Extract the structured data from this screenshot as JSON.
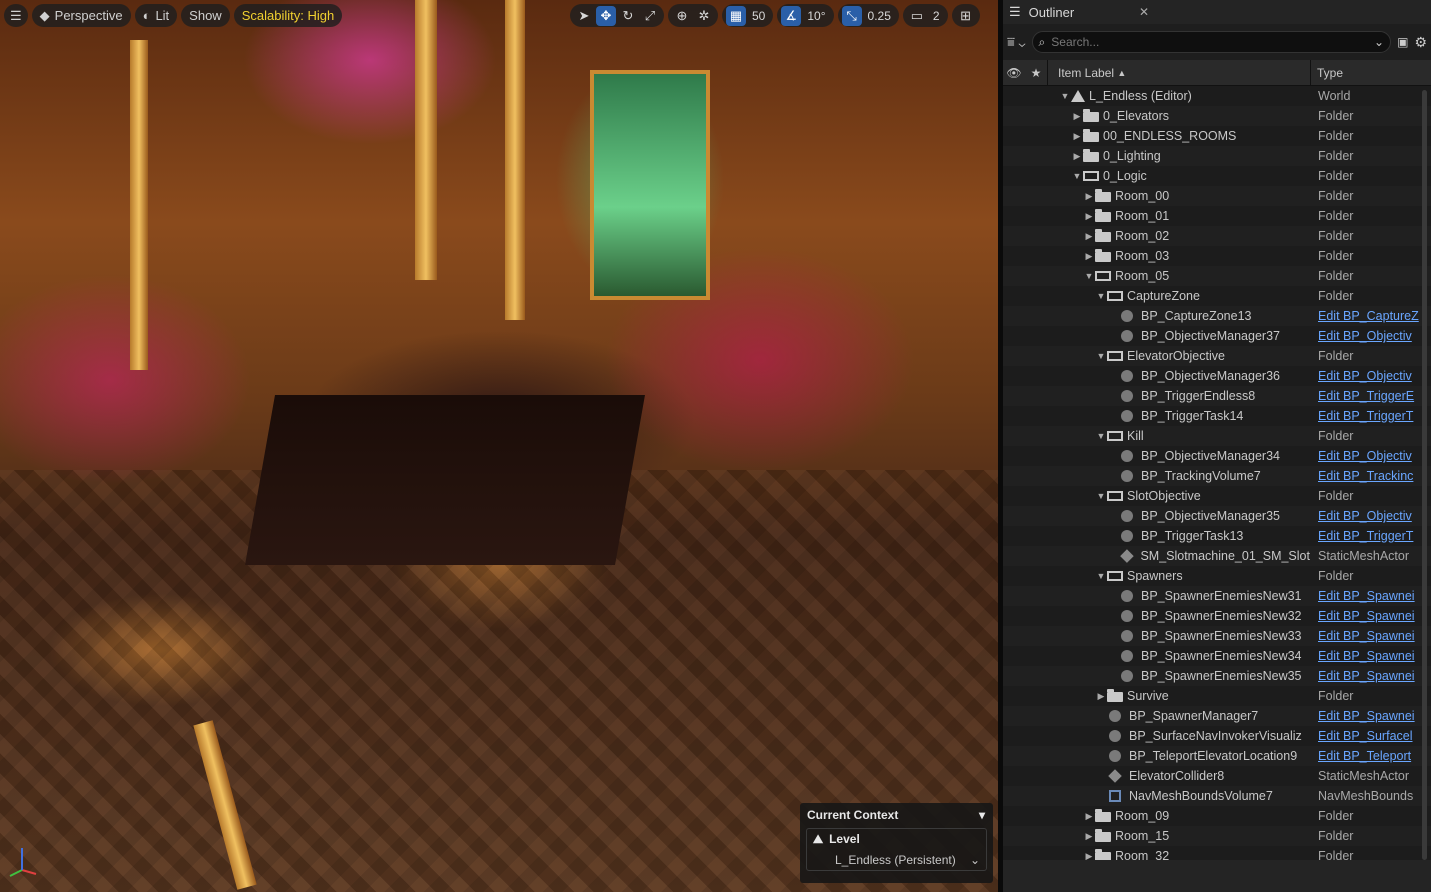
{
  "viewport": {
    "menu_icon": "hamburger-icon",
    "perspective_label": "Perspective",
    "lit_label": "Lit",
    "show_label": "Show",
    "scalability_label": "Scalability: High",
    "grid_snap_value": "50",
    "rotation_snap_value": "10°",
    "scale_snap_value": "0.25",
    "camera_speed_value": "2",
    "context": {
      "title": "Current Context",
      "level_label": "Level",
      "level_value": "L_Endless (Persistent)"
    }
  },
  "outliner": {
    "tab_title": "Outliner",
    "search_placeholder": "Search...",
    "col_label": "Item Label",
    "col_type": "Type",
    "rows": [
      {
        "indent": 0,
        "arrow": "▼",
        "icon": "world",
        "label": "L_Endless (Editor)",
        "type": "World",
        "link": false
      },
      {
        "indent": 1,
        "arrow": "▶",
        "icon": "folder",
        "label": "0_Elevators",
        "type": "Folder",
        "link": false
      },
      {
        "indent": 1,
        "arrow": "▶",
        "icon": "folder",
        "label": "00_ENDLESS_ROOMS",
        "type": "Folder",
        "link": false
      },
      {
        "indent": 1,
        "arrow": "▶",
        "icon": "folder",
        "label": "0_Lighting",
        "type": "Folder",
        "link": false
      },
      {
        "indent": 1,
        "arrow": "▼",
        "icon": "folder-open",
        "label": "0_Logic",
        "type": "Folder",
        "link": false
      },
      {
        "indent": 2,
        "arrow": "▶",
        "icon": "folder",
        "label": "Room_00",
        "type": "Folder",
        "link": false
      },
      {
        "indent": 2,
        "arrow": "▶",
        "icon": "folder",
        "label": "Room_01",
        "type": "Folder",
        "link": false
      },
      {
        "indent": 2,
        "arrow": "▶",
        "icon": "folder",
        "label": "Room_02",
        "type": "Folder",
        "link": false
      },
      {
        "indent": 2,
        "arrow": "▶",
        "icon": "folder",
        "label": "Room_03",
        "type": "Folder",
        "link": false
      },
      {
        "indent": 2,
        "arrow": "▼",
        "icon": "folder-open",
        "label": "Room_05",
        "type": "Folder",
        "link": false
      },
      {
        "indent": 3,
        "arrow": "▼",
        "icon": "folder-open",
        "label": "CaptureZone",
        "type": "Folder",
        "link": false
      },
      {
        "indent": 4,
        "arrow": "",
        "icon": "actor",
        "label": "BP_CaptureZone13",
        "type": "Edit BP_CaptureZ",
        "link": true
      },
      {
        "indent": 4,
        "arrow": "",
        "icon": "actor",
        "label": "BP_ObjectiveManager37",
        "type": "Edit BP_Objectiv",
        "link": true
      },
      {
        "indent": 3,
        "arrow": "▼",
        "icon": "folder-open",
        "label": "ElevatorObjective",
        "type": "Folder",
        "link": false
      },
      {
        "indent": 4,
        "arrow": "",
        "icon": "actor",
        "label": "BP_ObjectiveManager36",
        "type": "Edit BP_Objectiv",
        "link": true
      },
      {
        "indent": 4,
        "arrow": "",
        "icon": "actor",
        "label": "BP_TriggerEndless8",
        "type": "Edit BP_TriggerE",
        "link": true
      },
      {
        "indent": 4,
        "arrow": "",
        "icon": "actor",
        "label": "BP_TriggerTask14",
        "type": "Edit BP_TriggerT",
        "link": true
      },
      {
        "indent": 3,
        "arrow": "▼",
        "icon": "folder-open",
        "label": "Kill",
        "type": "Folder",
        "link": false
      },
      {
        "indent": 4,
        "arrow": "",
        "icon": "actor",
        "label": "BP_ObjectiveManager34",
        "type": "Edit BP_Objectiv",
        "link": true
      },
      {
        "indent": 4,
        "arrow": "",
        "icon": "actor",
        "label": "BP_TrackingVolume7",
        "type": "Edit BP_Trackinc",
        "link": true
      },
      {
        "indent": 3,
        "arrow": "▼",
        "icon": "folder-open",
        "label": "SlotObjective",
        "type": "Folder",
        "link": false
      },
      {
        "indent": 4,
        "arrow": "",
        "icon": "actor",
        "label": "BP_ObjectiveManager35",
        "type": "Edit BP_Objectiv",
        "link": true
      },
      {
        "indent": 4,
        "arrow": "",
        "icon": "actor",
        "label": "BP_TriggerTask13",
        "type": "Edit BP_TriggerT",
        "link": true
      },
      {
        "indent": 4,
        "arrow": "",
        "icon": "mesh",
        "label": "SM_Slotmachine_01_SM_Slot",
        "type": "StaticMeshActor",
        "link": false
      },
      {
        "indent": 3,
        "arrow": "▼",
        "icon": "folder-open",
        "label": "Spawners",
        "type": "Folder",
        "link": false
      },
      {
        "indent": 4,
        "arrow": "",
        "icon": "actor",
        "label": "BP_SpawnerEnemiesNew31",
        "type": "Edit BP_Spawnei",
        "link": true
      },
      {
        "indent": 4,
        "arrow": "",
        "icon": "actor",
        "label": "BP_SpawnerEnemiesNew32",
        "type": "Edit BP_Spawnei",
        "link": true
      },
      {
        "indent": 4,
        "arrow": "",
        "icon": "actor",
        "label": "BP_SpawnerEnemiesNew33",
        "type": "Edit BP_Spawnei",
        "link": true
      },
      {
        "indent": 4,
        "arrow": "",
        "icon": "actor",
        "label": "BP_SpawnerEnemiesNew34",
        "type": "Edit BP_Spawnei",
        "link": true
      },
      {
        "indent": 4,
        "arrow": "",
        "icon": "actor",
        "label": "BP_SpawnerEnemiesNew35",
        "type": "Edit BP_Spawnei",
        "link": true
      },
      {
        "indent": 3,
        "arrow": "▶",
        "icon": "folder",
        "label": "Survive",
        "type": "Folder",
        "link": false
      },
      {
        "indent": 3,
        "arrow": "",
        "icon": "actor",
        "label": "BP_SpawnerManager7",
        "type": "Edit BP_Spawnei",
        "link": true
      },
      {
        "indent": 3,
        "arrow": "",
        "icon": "actor",
        "label": "BP_SurfaceNavInvokerVisualiz",
        "type": "Edit BP_Surfacel",
        "link": true
      },
      {
        "indent": 3,
        "arrow": "",
        "icon": "actor",
        "label": "BP_TeleportElevatorLocation9",
        "type": "Edit BP_Teleport",
        "link": true
      },
      {
        "indent": 3,
        "arrow": "",
        "icon": "mesh",
        "label": "ElevatorCollider8",
        "type": "StaticMeshActor",
        "link": false
      },
      {
        "indent": 3,
        "arrow": "",
        "icon": "nav",
        "label": "NavMeshBoundsVolume7",
        "type": "NavMeshBounds",
        "link": false
      },
      {
        "indent": 2,
        "arrow": "▶",
        "icon": "folder",
        "label": "Room_09",
        "type": "Folder",
        "link": false
      },
      {
        "indent": 2,
        "arrow": "▶",
        "icon": "folder",
        "label": "Room_15",
        "type": "Folder",
        "link": false
      },
      {
        "indent": 2,
        "arrow": "▶",
        "icon": "folder",
        "label": "Room_32",
        "type": "Folder",
        "link": false
      }
    ]
  }
}
